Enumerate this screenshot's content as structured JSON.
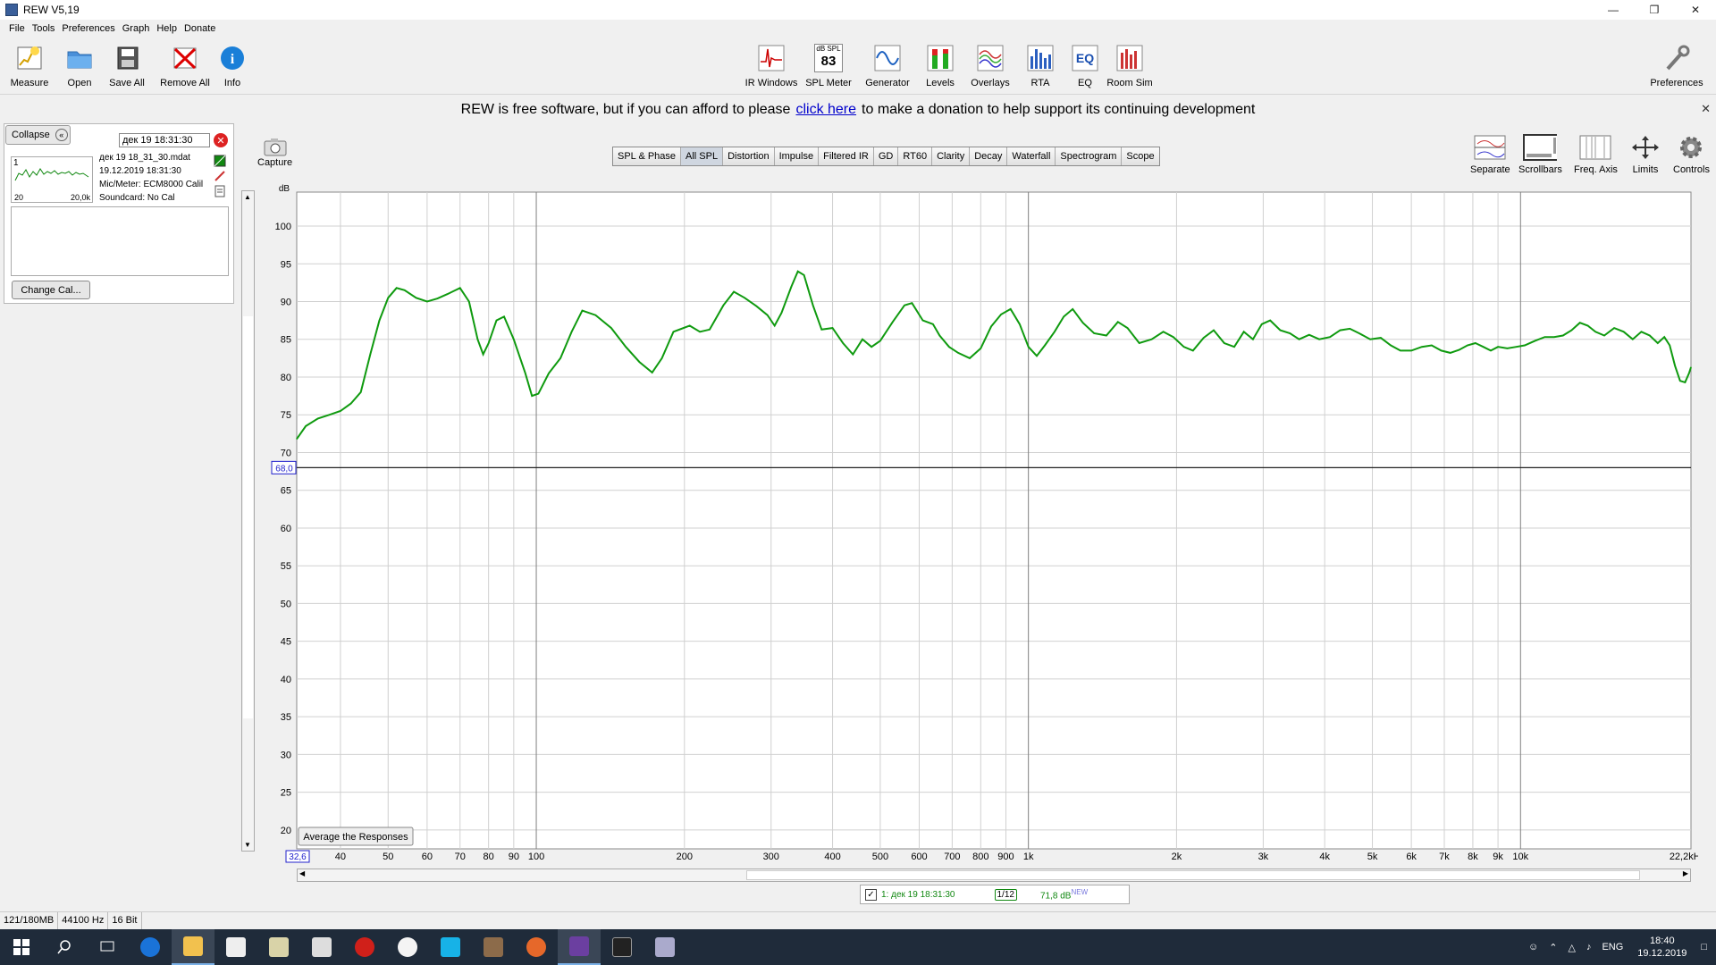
{
  "window": {
    "title": "REW V5,19"
  },
  "menu": [
    "File",
    "Tools",
    "Preferences",
    "Graph",
    "Help",
    "Donate"
  ],
  "toolbar_left": [
    {
      "label": "Measure",
      "icon": "measure-icon"
    },
    {
      "label": "Open",
      "icon": "folder-open-icon"
    },
    {
      "label": "Save All",
      "icon": "save-all-icon"
    },
    {
      "label": "Remove All",
      "icon": "remove-all-icon"
    },
    {
      "label": "Info",
      "icon": "info-icon"
    }
  ],
  "toolbar_center": [
    {
      "label": "IR Windows",
      "icon": "ir-windows-icon"
    },
    {
      "label": "SPL Meter",
      "icon": "spl-meter-icon"
    },
    {
      "label": "Generator",
      "icon": "generator-icon"
    },
    {
      "label": "Levels",
      "icon": "levels-icon"
    },
    {
      "label": "Overlays",
      "icon": "overlays-icon"
    },
    {
      "label": "RTA",
      "icon": "rta-icon"
    },
    {
      "label": "EQ",
      "icon": "eq-icon"
    },
    {
      "label": "Room Sim",
      "icon": "room-sim-icon"
    }
  ],
  "spl_meter": {
    "unit": "dB SPL",
    "value": "83"
  },
  "toolbar_right": {
    "label": "Preferences",
    "icon": "wrench-icon"
  },
  "banner": {
    "before": "REW is free software, but if you can afford to please",
    "link": "click here",
    "after": "to make a donation to help support its continuing development"
  },
  "panel": {
    "collapse_label": "Collapse",
    "name_value": "дек 19 18:31:30",
    "thumb_num": "1",
    "thumb_lo": "20",
    "thumb_hi": "20,0k",
    "file": "дек 19 18_31_30.mdat",
    "date": "19.12.2019 18:31:30",
    "mic": "Mic/Meter: ECM8000 Calil",
    "soundcard": "Soundcard: No Cal",
    "change_cal": "Change Cal..."
  },
  "capture_label": "Capture",
  "tabs": [
    "SPL & Phase",
    "All SPL",
    "Distortion",
    "Impulse",
    "Filtered IR",
    "GD",
    "RT60",
    "Clarity",
    "Decay",
    "Waterfall",
    "Spectrogram",
    "Scope"
  ],
  "active_tab": "All SPL",
  "right_tools": [
    {
      "label": "Separate",
      "icon": "separate-icon"
    },
    {
      "label": "Scrollbars",
      "icon": "scrollbars-icon"
    },
    {
      "label": "Freq. Axis",
      "icon": "freq-axis-icon"
    },
    {
      "label": "Limits",
      "icon": "limits-icon"
    },
    {
      "label": "Controls",
      "icon": "gear-icon"
    }
  ],
  "average_button": "Average the Responses",
  "legend": {
    "name": "1: дек 19 18:31:30",
    "smoothing": "1/12",
    "spl": "71,8 dB",
    "spl_tag": "NEW"
  },
  "status": [
    "121/180MB",
    "44100 Hz",
    "16 Bit"
  ],
  "taskbar": {
    "lang": "ENG",
    "time": "18:40",
    "date": "19.12.2019"
  },
  "colors": {
    "trace": "#0f9a0f",
    "grid": "#d0d0d0",
    "major_grid": "#808080"
  },
  "chart_data": {
    "type": "line",
    "ylabel": "dB",
    "x_scale": "log",
    "xlim": [
      32.6,
      22200
    ],
    "ylim": [
      17.5,
      104.5
    ],
    "xlim_label": "32,6",
    "xmax_label": "22,2kHz",
    "yticks": [
      20,
      25,
      30,
      35,
      40,
      45,
      50,
      55,
      60,
      65,
      70,
      75,
      80,
      85,
      90,
      95,
      100
    ],
    "xticks": [
      {
        "v": 40,
        "l": "40"
      },
      {
        "v": 50,
        "l": "50"
      },
      {
        "v": 60,
        "l": "60"
      },
      {
        "v": 70,
        "l": "70"
      },
      {
        "v": 80,
        "l": "80"
      },
      {
        "v": 90,
        "l": "90"
      },
      {
        "v": 100,
        "l": "100"
      },
      {
        "v": 200,
        "l": "200"
      },
      {
        "v": 300,
        "l": "300"
      },
      {
        "v": 400,
        "l": "400"
      },
      {
        "v": 500,
        "l": "500"
      },
      {
        "v": 600,
        "l": "600"
      },
      {
        "v": 700,
        "l": "700"
      },
      {
        "v": 800,
        "l": "800"
      },
      {
        "v": 900,
        "l": "900"
      },
      {
        "v": 1000,
        "l": "1k"
      },
      {
        "v": 2000,
        "l": "2k"
      },
      {
        "v": 3000,
        "l": "3k"
      },
      {
        "v": 4000,
        "l": "4k"
      },
      {
        "v": 5000,
        "l": "5k"
      },
      {
        "v": 6000,
        "l": "6k"
      },
      {
        "v": 7000,
        "l": "7k"
      },
      {
        "v": 8000,
        "l": "8k"
      },
      {
        "v": 9000,
        "l": "9k"
      },
      {
        "v": 10000,
        "l": "10k"
      }
    ],
    "reference_level": 68.0,
    "reference_label": "68,0",
    "series": [
      {
        "points": [
          [
            32.6,
            71.8
          ],
          [
            34,
            73.5
          ],
          [
            36,
            74.5
          ],
          [
            38,
            75
          ],
          [
            40,
            75.5
          ],
          [
            42,
            76.5
          ],
          [
            44,
            78
          ],
          [
            46,
            83
          ],
          [
            48,
            87.5
          ],
          [
            50,
            90.5
          ],
          [
            52,
            91.8
          ],
          [
            54,
            91.5
          ],
          [
            57,
            90.5
          ],
          [
            60,
            90
          ],
          [
            63,
            90.4
          ],
          [
            66,
            91
          ],
          [
            70,
            91.8
          ],
          [
            73,
            90
          ],
          [
            76,
            85
          ],
          [
            78,
            83
          ],
          [
            80,
            84.5
          ],
          [
            83,
            87.5
          ],
          [
            86,
            88
          ],
          [
            90,
            85
          ],
          [
            95,
            80.5
          ],
          [
            98,
            77.5
          ],
          [
            101,
            77.8
          ],
          [
            106,
            80.5
          ],
          [
            112,
            82.5
          ],
          [
            118,
            86
          ],
          [
            124,
            88.8
          ],
          [
            132,
            88.2
          ],
          [
            142,
            86.5
          ],
          [
            152,
            84
          ],
          [
            162,
            82
          ],
          [
            172,
            80.6
          ],
          [
            180,
            82.5
          ],
          [
            190,
            86
          ],
          [
            205,
            86.8
          ],
          [
            215,
            86
          ],
          [
            225,
            86.3
          ],
          [
            240,
            89.5
          ],
          [
            252,
            91.3
          ],
          [
            265,
            90.5
          ],
          [
            280,
            89.4
          ],
          [
            295,
            88.2
          ],
          [
            305,
            86.8
          ],
          [
            315,
            88.5
          ],
          [
            330,
            92
          ],
          [
            340,
            94
          ],
          [
            350,
            93.5
          ],
          [
            365,
            89.5
          ],
          [
            380,
            86.3
          ],
          [
            400,
            86.5
          ],
          [
            420,
            84.5
          ],
          [
            440,
            83
          ],
          [
            460,
            85
          ],
          [
            480,
            84
          ],
          [
            500,
            84.8
          ],
          [
            530,
            87.3
          ],
          [
            560,
            89.5
          ],
          [
            580,
            89.8
          ],
          [
            610,
            87.5
          ],
          [
            640,
            87
          ],
          [
            660,
            85.5
          ],
          [
            690,
            84
          ],
          [
            720,
            83.2
          ],
          [
            760,
            82.5
          ],
          [
            800,
            83.8
          ],
          [
            840,
            86.7
          ],
          [
            880,
            88.3
          ],
          [
            920,
            89
          ],
          [
            960,
            87
          ],
          [
            1000,
            84
          ],
          [
            1040,
            82.8
          ],
          [
            1080,
            84.2
          ],
          [
            1130,
            86
          ],
          [
            1180,
            88
          ],
          [
            1230,
            89
          ],
          [
            1290,
            87.2
          ],
          [
            1360,
            85.8
          ],
          [
            1440,
            85.5
          ],
          [
            1520,
            87.3
          ],
          [
            1590,
            86.5
          ],
          [
            1680,
            84.5
          ],
          [
            1780,
            85
          ],
          [
            1880,
            86
          ],
          [
            1970,
            85.3
          ],
          [
            2070,
            84
          ],
          [
            2160,
            83.5
          ],
          [
            2270,
            85.2
          ],
          [
            2380,
            86.2
          ],
          [
            2500,
            84.5
          ],
          [
            2620,
            84
          ],
          [
            2740,
            86
          ],
          [
            2860,
            85
          ],
          [
            2980,
            87
          ],
          [
            3100,
            87.5
          ],
          [
            3250,
            86.2
          ],
          [
            3400,
            85.8
          ],
          [
            3550,
            85
          ],
          [
            3720,
            85.6
          ],
          [
            3900,
            85
          ],
          [
            4100,
            85.3
          ],
          [
            4300,
            86.2
          ],
          [
            4500,
            86.4
          ],
          [
            4700,
            85.8
          ],
          [
            4950,
            85
          ],
          [
            5200,
            85.2
          ],
          [
            5450,
            84.2
          ],
          [
            5700,
            83.5
          ],
          [
            6000,
            83.5
          ],
          [
            6300,
            84
          ],
          [
            6600,
            84.2
          ],
          [
            6900,
            83.5
          ],
          [
            7200,
            83.2
          ],
          [
            7500,
            83.6
          ],
          [
            7800,
            84.2
          ],
          [
            8100,
            84.5
          ],
          [
            8400,
            84
          ],
          [
            8700,
            83.5
          ],
          [
            9000,
            84
          ],
          [
            9400,
            83.8
          ],
          [
            9800,
            84
          ],
          [
            10200,
            84.2
          ],
          [
            10700,
            84.8
          ],
          [
            11200,
            85.3
          ],
          [
            11700,
            85.3
          ],
          [
            12200,
            85.5
          ],
          [
            12700,
            86.2
          ],
          [
            13200,
            87.2
          ],
          [
            13700,
            86.8
          ],
          [
            14200,
            86
          ],
          [
            14800,
            85.5
          ],
          [
            15500,
            86.5
          ],
          [
            16200,
            86
          ],
          [
            16900,
            85
          ],
          [
            17600,
            86
          ],
          [
            18300,
            85.5
          ],
          [
            19000,
            84.5
          ],
          [
            19600,
            85.3
          ],
          [
            20100,
            84.2
          ],
          [
            20600,
            81.5
          ],
          [
            21100,
            79.5
          ],
          [
            21600,
            79.3
          ],
          [
            22000,
            80.5
          ],
          [
            22200,
            81.3
          ]
        ]
      }
    ]
  }
}
